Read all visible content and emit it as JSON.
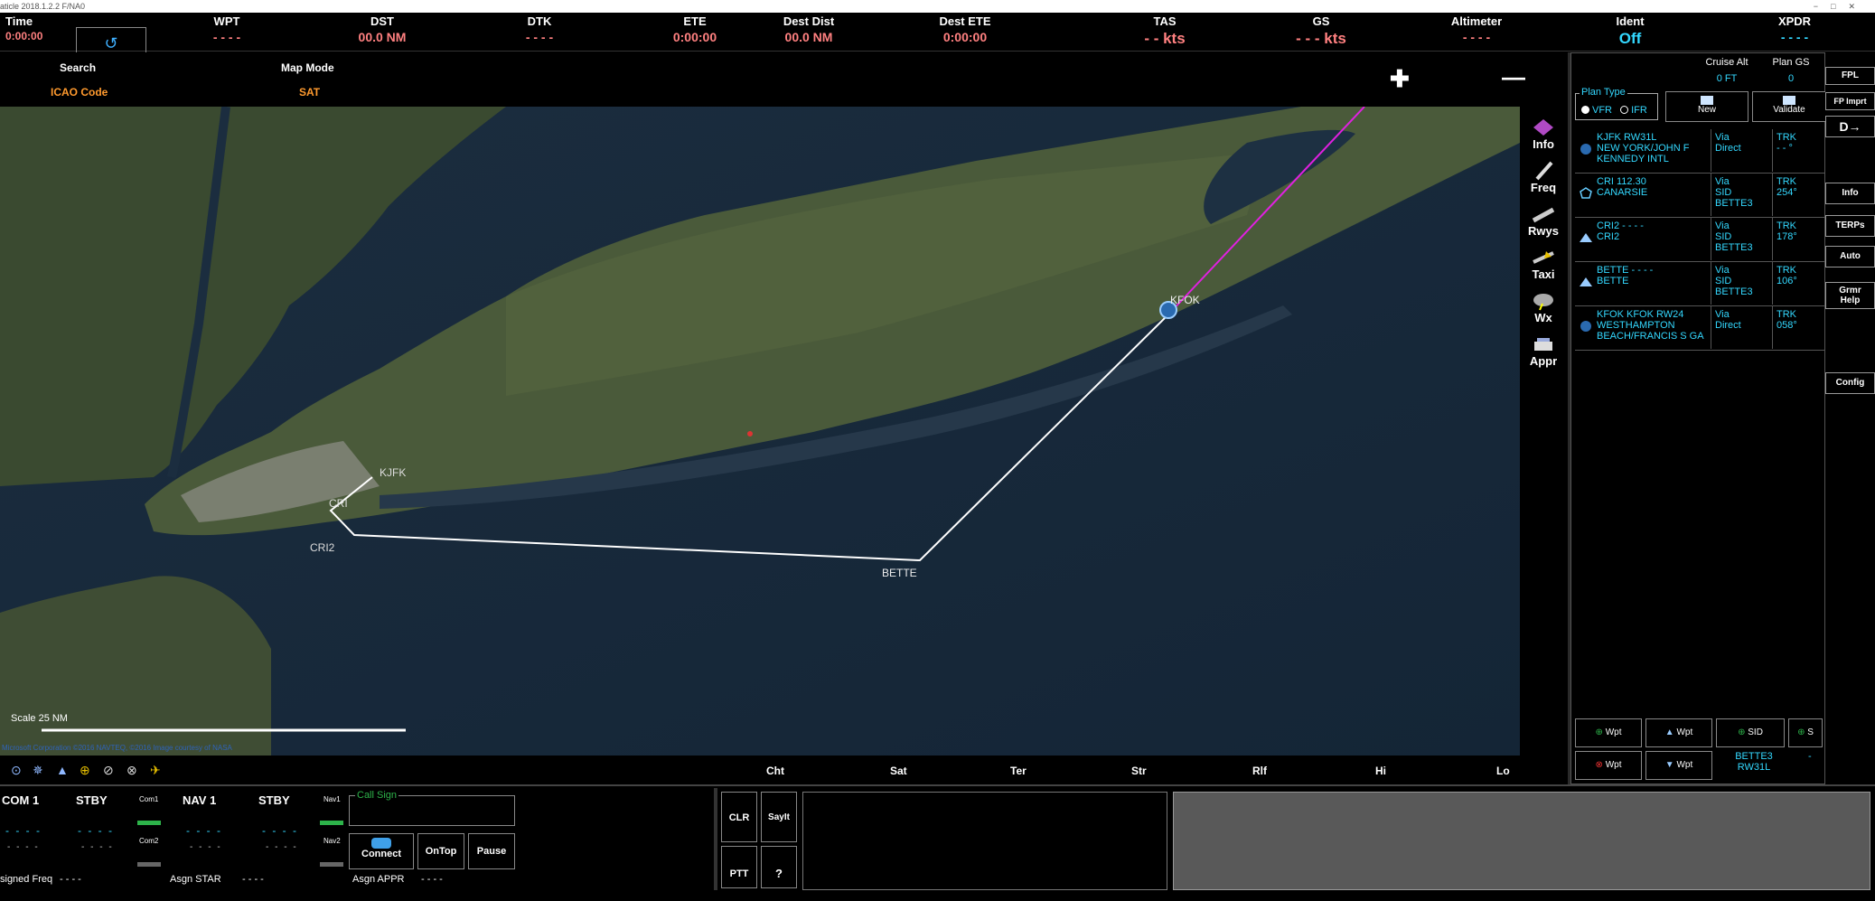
{
  "window": {
    "title": "aticle 2018.1.2.2 F/NA0",
    "controls": [
      "−",
      "□",
      "✕"
    ]
  },
  "topbar": {
    "time": {
      "label": "Time",
      "value": "0:00:00"
    },
    "wpt": {
      "label": "WPT",
      "value": "- - - -"
    },
    "dst": {
      "label": "DST",
      "value": "00.0 NM"
    },
    "dtk": {
      "label": "DTK",
      "value": "- - - -"
    },
    "ete": {
      "label": "ETE",
      "value": "0:00:00"
    },
    "dest_dist": {
      "label": "Dest Dist",
      "value": "00.0 NM"
    },
    "dest_ete": {
      "label": "Dest ETE",
      "value": "0:00:00"
    },
    "tas": {
      "label": "TAS",
      "value": "- - kts"
    },
    "gs": {
      "label": "GS",
      "value": "- - - kts"
    },
    "altimeter": {
      "label": "Altimeter",
      "value": "- - - -"
    },
    "ident": {
      "label": "Ident",
      "value": "Off"
    },
    "xpdr": {
      "label": "XPDR",
      "value": "- - - -"
    }
  },
  "mapheader": {
    "search_label": "Search",
    "search_value": "ICAO Code",
    "mapmode_label": "Map Mode",
    "mapmode_value": "SAT",
    "zoom_in": "✚",
    "zoom_out": "—"
  },
  "map": {
    "waypoints": {
      "kjfk": "KJFK",
      "cri": "CRI",
      "cri2": "CRI2",
      "bette": "BETTE",
      "kfok": "KFOK"
    },
    "scale_label": "Scale 25 NM",
    "copyright": "Microsoft Corporation ©2016 NAVTEQ, ©2016 Image courtesy of NASA"
  },
  "maptools": [
    {
      "label": "Info",
      "icon": "info-icon"
    },
    {
      "label": "Freq",
      "icon": "freq-icon"
    },
    {
      "label": "Rwys",
      "icon": "runway-icon"
    },
    {
      "label": "Taxi",
      "icon": "taxi-icon"
    },
    {
      "label": "Wx",
      "icon": "weather-icon"
    },
    {
      "label": "Appr",
      "icon": "approach-icon"
    }
  ],
  "mapfooter": {
    "buttons": [
      "Cht",
      "Sat",
      "Ter",
      "Str",
      "Rlf",
      "Hi",
      "Lo"
    ]
  },
  "fpl": {
    "cruise_alt_label": "Cruise Alt",
    "cruise_alt_value": "0 FT",
    "plan_gs_label": "Plan GS",
    "plan_gs_value": "0",
    "plan_type_label": "Plan Type",
    "vfr": "VFR",
    "ifr": "IFR",
    "new_label": "New",
    "validate_label": "Validate",
    "rows": [
      {
        "name": "KJFK  RW31L\nNEW YORK/JOHN F\nKENNEDY INTL",
        "via": "Via\nDirect",
        "trk": "TRK\n- - °"
      },
      {
        "name": "CRI   112.30\nCANARSIE",
        "via": "Via\nSID\nBETTE3",
        "trk": "TRK\n254°"
      },
      {
        "name": "CRI2   - - - -\nCRI2",
        "via": "Via\nSID\nBETTE3",
        "trk": "TRK\n178°"
      },
      {
        "name": "BETTE   - - - -\nBETTE",
        "via": "Via\nSID\nBETTE3",
        "trk": "TRK\n106°"
      },
      {
        "name": "KFOK   KFOK RW24\nWESTHAMPTON\nBEACH/FRANCIS S GA",
        "via": "Via\nDirect",
        "trk": "TRK\n058°"
      }
    ],
    "add_wpt": "Wpt",
    "up_wpt": "Wpt",
    "sid": "SID",
    "star": "S",
    "del_wpt": "Wpt",
    "down_wpt": "Wpt",
    "procedure": "BETTE3\nRW31L",
    "procedure_dash": "-"
  },
  "rightbar": {
    "fpl": "FPL",
    "fp_import": "FP Imprt",
    "direct_to": "D→",
    "info": "Info",
    "terps": "TERPs",
    "auto": "Auto",
    "grmr_help": "Grmr\nHelp",
    "config": "Config"
  },
  "bottom": {
    "com1_label": "COM 1",
    "stby1_label": "STBY",
    "com1_small": "Com1",
    "com2_small": "Com2",
    "nav1_label": "NAV 1",
    "stby2_label": "STBY",
    "nav1_small": "Nav1",
    "nav2_small": "Nav2",
    "freq_dash_a": "- - - -",
    "freq_dash_b": "- - - -",
    "freq_dash_c": "- - - -",
    "freq_dash_d": "- - - -",
    "freq_dash_e": "- - - -",
    "freq_dash_f": "- - - -",
    "freq_dash_g": "- - - -",
    "freq_dash_h": "- - - -",
    "call_sign": "Call Sign",
    "connect": "Connect",
    "ontop": "OnTop",
    "pause": "Pause",
    "assigned_freq_label": "signed Freq",
    "assigned_freq_value": "- - - -",
    "asgn_star_label": "Asgn STAR",
    "asgn_star_value": "- - - -",
    "asgn_appr_label": "Asgn APPR",
    "asgn_appr_value": "- - - -",
    "clr": "CLR",
    "sayit": "SayIt",
    "ptt": "PTT",
    "help": "?"
  }
}
